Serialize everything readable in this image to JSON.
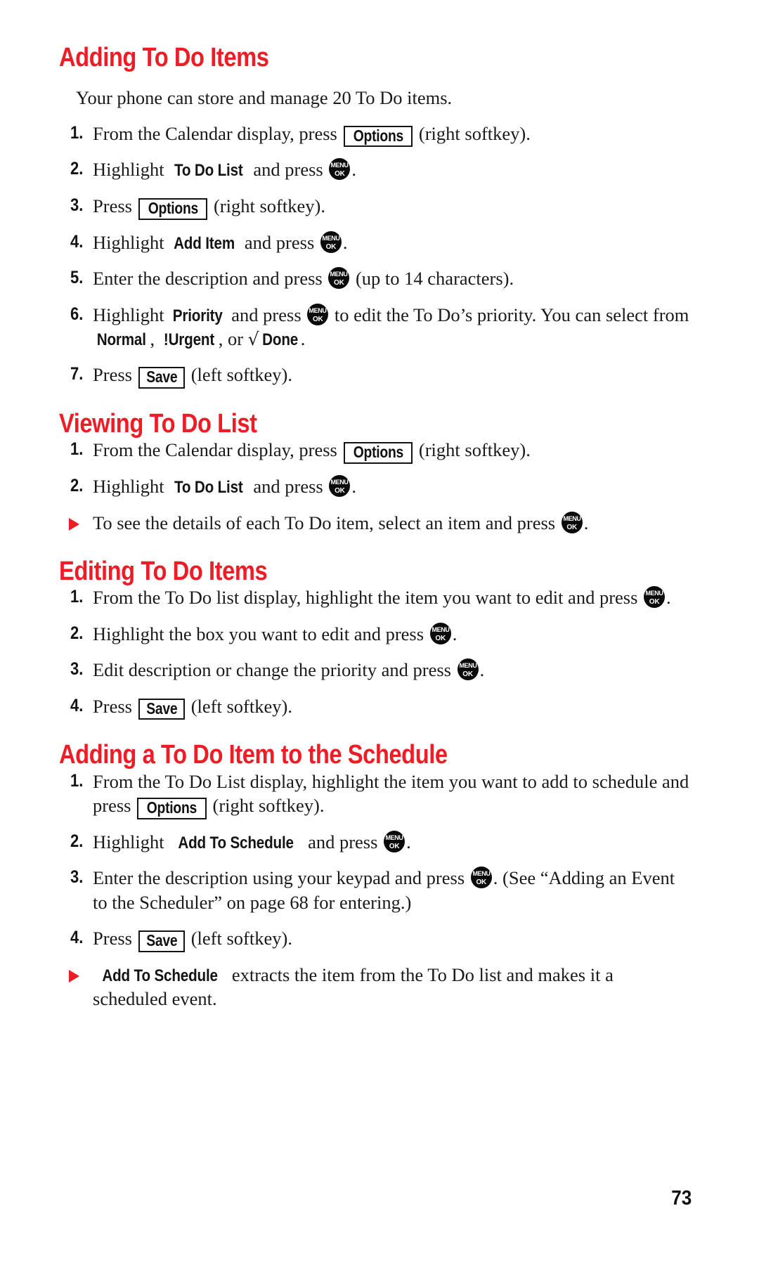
{
  "page": {
    "number": "73",
    "accent_color": "#ee1c25",
    "text_color": "#1a1a1a"
  },
  "icons": {
    "menu_ok": {
      "top": "MENU",
      "bottom": "OK",
      "name": "menu-ok-key-icon"
    },
    "bullet": "red-triangle-bullet"
  },
  "sections": [
    {
      "id": "adding-to-do-items",
      "heading": "Adding To Do Items",
      "intro": "Your phone can store and manage 20 To Do items.",
      "steps": [
        {
          "num": "1.",
          "parts": [
            {
              "type": "text",
              "value": "From the Calendar display, press "
            },
            {
              "type": "softkey",
              "value": "Options"
            },
            {
              "type": "text",
              "value": " (right softkey)."
            }
          ]
        },
        {
          "num": "2.",
          "parts": [
            {
              "type": "text",
              "value": "Highlight "
            },
            {
              "type": "ui",
              "value": "To Do List"
            },
            {
              "type": "text",
              "value": " and press "
            },
            {
              "type": "menuok"
            },
            {
              "type": "text",
              "value": "."
            }
          ]
        },
        {
          "num": "3.",
          "parts": [
            {
              "type": "text",
              "value": "Press "
            },
            {
              "type": "softkey",
              "value": "Options"
            },
            {
              "type": "text",
              "value": " (right softkey)."
            }
          ]
        },
        {
          "num": "4.",
          "parts": [
            {
              "type": "text",
              "value": "Highlight "
            },
            {
              "type": "ui",
              "value": "Add Item"
            },
            {
              "type": "text",
              "value": " and press "
            },
            {
              "type": "menuok"
            },
            {
              "type": "text",
              "value": "."
            }
          ]
        },
        {
          "num": "5.",
          "parts": [
            {
              "type": "text",
              "value": "Enter the description and press "
            },
            {
              "type": "menuok"
            },
            {
              "type": "text",
              "value": " (up to 14 characters)."
            }
          ]
        },
        {
          "num": "6.",
          "parts": [
            {
              "type": "text",
              "value": "Highlight "
            },
            {
              "type": "ui",
              "value": "Priority"
            },
            {
              "type": "text",
              "value": " and press "
            },
            {
              "type": "menuok"
            },
            {
              "type": "text",
              "value": " to edit the To Do’s priority. You can select from "
            },
            {
              "type": "ui",
              "value": "Normal"
            },
            {
              "type": "text",
              "value": ", "
            },
            {
              "type": "ui",
              "value": "!Urgent"
            },
            {
              "type": "text",
              "value": ", or "
            },
            {
              "type": "radical",
              "value": "√"
            },
            {
              "type": "ui",
              "value": "Done"
            },
            {
              "type": "text",
              "value": "."
            }
          ]
        },
        {
          "num": "7.",
          "parts": [
            {
              "type": "text",
              "value": "Press "
            },
            {
              "type": "softkey",
              "value": "Save"
            },
            {
              "type": "text",
              "value": " (left softkey)."
            }
          ]
        }
      ]
    },
    {
      "id": "viewing-to-do-list",
      "heading": "Viewing To Do List",
      "steps": [
        {
          "num": "1.",
          "parts": [
            {
              "type": "text",
              "value": "From the Calendar display, press "
            },
            {
              "type": "softkey",
              "value": "Options"
            },
            {
              "type": "text",
              "value": " (right softkey)."
            }
          ]
        },
        {
          "num": "2.",
          "parts": [
            {
              "type": "text",
              "value": "Highlight "
            },
            {
              "type": "ui",
              "value": "To Do List"
            },
            {
              "type": "text",
              "value": " and press "
            },
            {
              "type": "menuok"
            },
            {
              "type": "text",
              "value": "."
            }
          ]
        },
        {
          "bullet": true,
          "parts": [
            {
              "type": "text",
              "value": "To see the details of each To Do item, select an item and press "
            },
            {
              "type": "menuok"
            },
            {
              "type": "text",
              "value": "."
            }
          ]
        }
      ]
    },
    {
      "id": "editing-to-do-items",
      "heading": "Editing To Do Items",
      "steps": [
        {
          "num": "1.",
          "parts": [
            {
              "type": "text",
              "value": "From the To Do list display, highlight the item you want to edit and press "
            },
            {
              "type": "menuok"
            },
            {
              "type": "text",
              "value": "."
            }
          ]
        },
        {
          "num": "2.",
          "parts": [
            {
              "type": "text",
              "value": "Highlight the box you want to edit and press "
            },
            {
              "type": "menuok"
            },
            {
              "type": "text",
              "value": "."
            }
          ]
        },
        {
          "num": "3.",
          "parts": [
            {
              "type": "text",
              "value": "Edit description or change the priority and press "
            },
            {
              "type": "menuok"
            },
            {
              "type": "text",
              "value": "."
            }
          ]
        },
        {
          "num": "4.",
          "parts": [
            {
              "type": "text",
              "value": "Press "
            },
            {
              "type": "softkey",
              "value": "Save"
            },
            {
              "type": "text",
              "value": " (left softkey)."
            }
          ]
        }
      ]
    },
    {
      "id": "adding-a-to-do-item-to-the-schedule",
      "heading": "Adding a To Do Item to the Schedule",
      "steps": [
        {
          "num": "1.",
          "parts": [
            {
              "type": "text",
              "value": "From the To Do List display, highlight the item you want to add to schedule and press "
            },
            {
              "type": "softkey",
              "value": "Options"
            },
            {
              "type": "text",
              "value": " (right softkey)."
            }
          ]
        },
        {
          "num": "2.",
          "parts": [
            {
              "type": "text",
              "value": "Highlight "
            },
            {
              "type": "ui",
              "value": "Add To Schedule"
            },
            {
              "type": "text",
              "value": " and press "
            },
            {
              "type": "menuok"
            },
            {
              "type": "text",
              "value": "."
            }
          ]
        },
        {
          "num": "3.",
          "parts": [
            {
              "type": "text",
              "value": "Enter the description using your keypad and press "
            },
            {
              "type": "menuok"
            },
            {
              "type": "text",
              "value": ". (See “Adding an Event to the Scheduler” on page 68 for entering.)"
            }
          ]
        },
        {
          "num": "4.",
          "parts": [
            {
              "type": "text",
              "value": "Press "
            },
            {
              "type": "softkey",
              "value": "Save"
            },
            {
              "type": "text",
              "value": " (left softkey)."
            }
          ]
        },
        {
          "bullet": true,
          "parts": [
            {
              "type": "ui",
              "value": "Add To Schedule"
            },
            {
              "type": "text",
              "value": " extracts the item from the To Do list and makes it a scheduled event."
            }
          ]
        }
      ]
    }
  ]
}
